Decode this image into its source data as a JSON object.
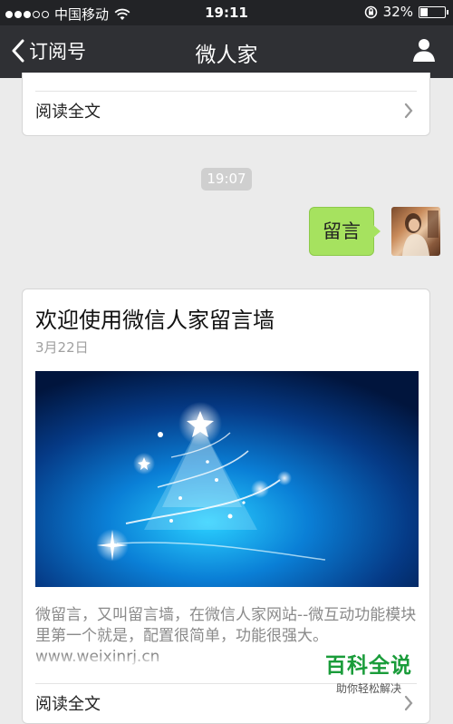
{
  "status_bar": {
    "carrier": "中国移动",
    "time": "19:11",
    "battery_percent": "32%",
    "battery_level": 0.32,
    "signal_icon": "signal-dots-icon",
    "wifi_icon": "wifi-icon",
    "lock_icon": "orientation-lock-icon"
  },
  "nav": {
    "back_label": "订阅号",
    "title": "微人家",
    "user_icon": "user-icon"
  },
  "top_card": {
    "read_more": "阅读全文"
  },
  "timestamp": "19:07",
  "message": {
    "text": "留言"
  },
  "article": {
    "title": "欢迎使用微信人家留言墙",
    "date": "3月22日",
    "summary": "微留言，又叫留言墙，在微信人家网站--微互动功能模块里第一个就是，配置很简单，功能很强大。www.weixinrj.cn",
    "read_more": "阅读全文"
  },
  "watermark": {
    "title": "百科全说",
    "subtitle": "助你轻松解决"
  },
  "colors": {
    "statusbar_bg": "#222326",
    "navbar_bg": "#2f3034",
    "bubble_green": "#a6e25f",
    "page_bg": "#ebebeb",
    "watermark_green": "#1a9c3a"
  }
}
